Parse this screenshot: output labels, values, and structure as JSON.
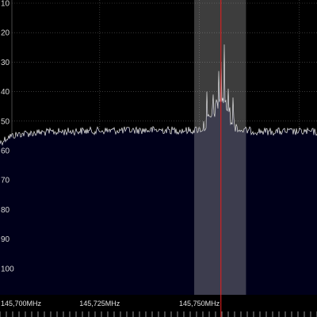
{
  "colors": {
    "background": "#000000",
    "grid": "#5a5a5a",
    "spectrum_top": "#3d7fd3",
    "spectrum_bottom": "#00001a",
    "trace": "#f0f0f0",
    "filter_band": "#bfbfbf",
    "center_line": "#e02020"
  },
  "y_axis": {
    "unit": "dB",
    "ticks": [
      "10",
      "20",
      "30",
      "40",
      "50",
      "60",
      "70",
      "80",
      "90",
      "100"
    ],
    "range": [
      10,
      100
    ]
  },
  "x_axis": {
    "range_mhz": [
      145.7,
      145.7795
    ],
    "ticks": [
      {
        "value": 145.7,
        "label": "145,700MHz"
      },
      {
        "value": 145.725,
        "label": "145,725MHz"
      },
      {
        "value": 145.75,
        "label": "145,750MHz"
      },
      {
        "value": 145.775,
        "label": ""
      }
    ]
  },
  "filter_passband_mhz": [
    145.7487,
    145.7617
  ],
  "center_frequency_mhz": 145.7554,
  "spectrum": {
    "noise_floor_db": [
      [
        145.7,
        57.5
      ],
      [
        145.702,
        55.5
      ],
      [
        145.705,
        54.5
      ],
      [
        145.71,
        54.0
      ],
      [
        145.72,
        53.5
      ],
      [
        145.73,
        53.3
      ],
      [
        145.74,
        53.2
      ],
      [
        145.748,
        53.3
      ],
      [
        145.7505,
        52.8
      ],
      [
        145.7525,
        50.0
      ],
      [
        145.7545,
        45.0
      ],
      [
        145.7555,
        41.5
      ],
      [
        145.7565,
        45.0
      ],
      [
        145.7585,
        50.5
      ],
      [
        145.76,
        53.2
      ],
      [
        145.765,
        53.6
      ],
      [
        145.7795,
        53.8
      ]
    ],
    "spikes": [
      {
        "f_mhz": 145.7518,
        "db": 40
      },
      {
        "f_mhz": 145.7535,
        "db": 41
      },
      {
        "f_mhz": 145.7548,
        "db": 33
      },
      {
        "f_mhz": 145.7555,
        "db": 30
      },
      {
        "f_mhz": 145.7562,
        "db": 24
      },
      {
        "f_mhz": 145.7572,
        "db": 39
      },
      {
        "f_mhz": 145.7585,
        "db": 42
      }
    ]
  }
}
